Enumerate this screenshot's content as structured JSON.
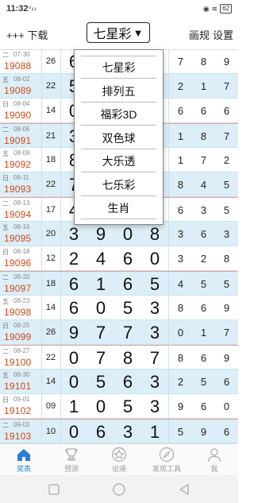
{
  "status": {
    "time": "11:32",
    "signal": "ᵒ ᵢₗ ᵢₗ",
    "battery": "62"
  },
  "header": {
    "left_action": "+++ 下载",
    "lottery_selected": "七星彩",
    "right_actions": [
      "画规",
      "设置"
    ]
  },
  "dropdown": {
    "options": [
      "七星彩",
      "排列五",
      "福彩3D",
      "双色球",
      "大乐透",
      "七乐彩",
      "生肖"
    ]
  },
  "rows": [
    {
      "weekday": "二",
      "date": "07-30",
      "issue": "19088",
      "sum": "26",
      "digits": [
        "6",
        "",
        "",
        ""
      ],
      "extra": [
        "7",
        "8",
        "9"
      ]
    },
    {
      "weekday": "五",
      "date": "08-02",
      "issue": "19089",
      "sum": "22",
      "digits": [
        "5",
        "",
        "",
        ""
      ],
      "extra": [
        "2",
        "1",
        "7"
      ]
    },
    {
      "weekday": "日",
      "date": "08-04",
      "issue": "19090",
      "sum": "14",
      "digits": [
        "0",
        "",
        "",
        ""
      ],
      "extra": [
        "6",
        "6",
        "6"
      ]
    },
    {
      "weekday": "二",
      "date": "08-06",
      "issue": "19091",
      "sum": "21",
      "digits": [
        "3",
        "",
        "",
        ""
      ],
      "extra": [
        "1",
        "8",
        "7"
      ]
    },
    {
      "weekday": "五",
      "date": "08-09",
      "issue": "19092",
      "sum": "18",
      "digits": [
        "8",
        "",
        "",
        ""
      ],
      "extra": [
        "1",
        "7",
        "2"
      ]
    },
    {
      "weekday": "日",
      "date": "08-11",
      "issue": "19093",
      "sum": "22",
      "digits": [
        "7",
        "",
        "",
        ""
      ],
      "extra": [
        "8",
        "4",
        "5"
      ]
    },
    {
      "weekday": "二",
      "date": "08-13",
      "issue": "19094",
      "sum": "17",
      "digits": [
        "4",
        "",
        "",
        ""
      ],
      "extra": [
        "6",
        "3",
        "5"
      ]
    },
    {
      "weekday": "五",
      "date": "08-16",
      "issue": "19095",
      "sum": "20",
      "digits": [
        "3",
        "9",
        "0",
        "8"
      ],
      "extra": [
        "3",
        "6",
        "3"
      ]
    },
    {
      "weekday": "日",
      "date": "08-18",
      "issue": "19096",
      "sum": "12",
      "digits": [
        "2",
        "4",
        "6",
        "0"
      ],
      "extra": [
        "3",
        "2",
        "8"
      ]
    },
    {
      "weekday": "二",
      "date": "08-20",
      "issue": "19097",
      "sum": "18",
      "digits": [
        "6",
        "1",
        "6",
        "5"
      ],
      "extra": [
        "4",
        "5",
        "5"
      ]
    },
    {
      "weekday": "五",
      "date": "08-23",
      "issue": "19098",
      "sum": "14",
      "digits": [
        "6",
        "0",
        "5",
        "3"
      ],
      "extra": [
        "8",
        "6",
        "9"
      ]
    },
    {
      "weekday": "日",
      "date": "08-25",
      "issue": "19099",
      "sum": "26",
      "digits": [
        "9",
        "7",
        "7",
        "3"
      ],
      "extra": [
        "0",
        "1",
        "7"
      ]
    },
    {
      "weekday": "二",
      "date": "08-27",
      "issue": "19100",
      "sum": "22",
      "digits": [
        "0",
        "7",
        "8",
        "7"
      ],
      "extra": [
        "8",
        "6",
        "9"
      ]
    },
    {
      "weekday": "五",
      "date": "08-30",
      "issue": "19101",
      "sum": "14",
      "digits": [
        "0",
        "5",
        "6",
        "3"
      ],
      "extra": [
        "2",
        "5",
        "6"
      ]
    },
    {
      "weekday": "日",
      "date": "09-01",
      "issue": "19102",
      "sum": "09",
      "digits": [
        "1",
        "0",
        "5",
        "3"
      ],
      "extra": [
        "9",
        "6",
        "0"
      ]
    },
    {
      "weekday": "二",
      "date": "09-03",
      "issue": "19103",
      "sum": "10",
      "digits": [
        "0",
        "6",
        "3",
        "1"
      ],
      "extra": [
        "5",
        "9",
        "6"
      ]
    }
  ],
  "bottom_nav": {
    "items": [
      {
        "label": "奖表",
        "icon": "home-icon",
        "active": true
      },
      {
        "label": "预测",
        "icon": "trophy-icon",
        "active": false
      },
      {
        "label": "论道",
        "icon": "star-icon",
        "active": false
      },
      {
        "label": "发现工具",
        "icon": "compass-icon",
        "active": false
      },
      {
        "label": "我",
        "icon": "person-icon",
        "active": false
      }
    ]
  },
  "colors": {
    "accent": "#2a7fd4",
    "issue_red": "#d24a1a",
    "row_alt": "#dceef7",
    "week_separator": "#e7a19a"
  }
}
